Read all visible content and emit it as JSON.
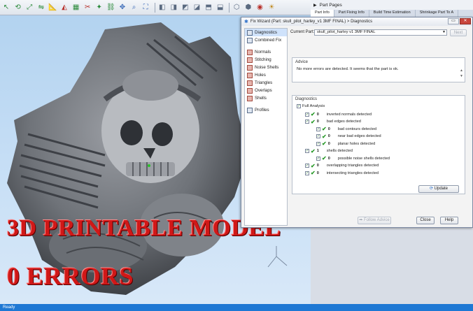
{
  "toolbar": {
    "icons": [
      "move",
      "rotate",
      "scale",
      "mirror",
      "measure",
      "select-triangles",
      "select-surface",
      "cut",
      "wand",
      "connect",
      "pan",
      "zoom",
      "fit",
      "view-front",
      "view-back",
      "view-left",
      "view-right",
      "view-top",
      "view-bottom",
      "wireframe",
      "solid",
      "color",
      "lights"
    ]
  },
  "viewport": {
    "overlay_line1": "3D PRINTABLE MODEL",
    "overlay_line2": "0 ERRORS"
  },
  "status_bar": {
    "text": "Ready"
  },
  "part_pages": {
    "title": "Part Pages",
    "tabs": [
      "Part Info",
      "Part Fixing Info",
      "Build Time Estimation",
      "Shrinkage Part To A"
    ]
  },
  "dialog": {
    "title": "Fix Wizard (Part: skull_pilot_harley_v1 3MF FINAL) > Diagnostics",
    "window_buttons": [
      "▭",
      "✕"
    ],
    "nav": [
      {
        "label": "Diagnostics",
        "selected": true
      },
      {
        "label": "Combined Fix",
        "selected": false
      },
      {
        "label": "Normals",
        "selected": false
      },
      {
        "label": "Stitching",
        "selected": false
      },
      {
        "label": "Noise Shells",
        "selected": false
      },
      {
        "label": "Holes",
        "selected": false
      },
      {
        "label": "Triangles",
        "selected": false
      },
      {
        "label": "Overlaps",
        "selected": false
      },
      {
        "label": "Shells",
        "selected": false
      },
      {
        "label": "Profiles",
        "selected": false
      }
    ],
    "current_part_label": "Current Part:",
    "current_part_value": "skull_pilot_harley v1 3MF FINAL",
    "next_button": "Next",
    "advice_title": "Advice",
    "advice_text": "No more errors are detected. It seems that the part is ok.",
    "diagnostics_title": "Diagnostics",
    "full_analysis_label": "Full Analysis",
    "rows": [
      {
        "count": "0",
        "label": "inverted normals detected",
        "indent": 0
      },
      {
        "count": "0",
        "label": "bad edges detected",
        "indent": 0
      },
      {
        "count": "0",
        "label": "bad contours detected",
        "indent": 1
      },
      {
        "count": "0",
        "label": "near bad edges detected",
        "indent": 1
      },
      {
        "count": "0",
        "label": "planar holes detected",
        "indent": 1
      },
      {
        "count": "1",
        "label": "shells detected",
        "indent": 0
      },
      {
        "count": "0",
        "label": "possible noise shells detected",
        "indent": 1
      },
      {
        "count": "0",
        "label": "overlapping triangles detected",
        "indent": 0
      },
      {
        "count": "0",
        "label": "intersecting triangles detected",
        "indent": 0
      }
    ],
    "update_button": "Update",
    "follow_advice_button": "Follow Advice",
    "close_button": "Close",
    "help_button": "Help"
  }
}
